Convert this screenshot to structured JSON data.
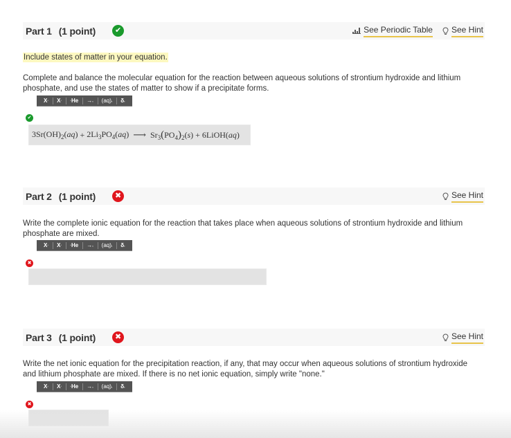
{
  "parts": [
    {
      "title": "Part 1",
      "points": "(1 point)",
      "status": "correct",
      "links": {
        "periodic_table": "See Periodic Table",
        "hint": "See Hint"
      },
      "note": "Include states of matter in your equation.",
      "question": "Complete and balance the molecular equation for the reaction between aqueous solutions of strontium hydroxide and lithium phosphate, and use the states of matter to show if a precipitate forms.",
      "answer_status": "correct",
      "answer": {
        "reactant1": {
          "coef": "3",
          "formula": "Sr(OH)",
          "sub": "2",
          "state": "aq"
        },
        "reactant2": {
          "coef": "2",
          "formula_a": "Li",
          "sub_a": "3",
          "formula_b": "PO",
          "sub_b": "4",
          "state": "aq"
        },
        "arrow": "⟶",
        "product1": {
          "formula_a": "Sr",
          "sub_a": "3",
          "formula_b": "PO",
          "sub_b": "4",
          "sub_c": "2",
          "state": "s"
        },
        "product2": {
          "coef": "6",
          "formula": "LiOH",
          "state": "aq"
        },
        "plus": "+"
      }
    },
    {
      "title": "Part 2",
      "points": "(1 point)",
      "status": "incorrect",
      "links": {
        "hint": "See Hint"
      },
      "question": "Write the complete ionic equation for the reaction that takes place when aqueous solutions of strontium hydroxide and lithium phosphate are mixed.",
      "answer_status": "incorrect",
      "answer_value": ""
    },
    {
      "title": "Part 3",
      "points": "(1 point)",
      "status": "incorrect",
      "links": {
        "hint": "See Hint"
      },
      "question": "Write the net ionic equation for the precipitation reaction, if any, that may occur when aqueous solutions of strontium hydroxide and lithium phosphate are mixed. If there is no net ionic equation, simply write \"none.\"",
      "answer_status": "incorrect",
      "answer_value": ""
    }
  ],
  "toolbar": {
    "superscript": "X",
    "subscript": "X",
    "isotope": "He",
    "arrow": "→",
    "state": "(aq)",
    "delta": "δ"
  },
  "icons": {
    "correct": "✔",
    "incorrect": "✖",
    "dropdown_marker": ","
  },
  "colors": {
    "correct": "#1a9a2c",
    "incorrect": "#e0161d",
    "link_underline": "#e8c44a",
    "highlight": "#fdf8c0"
  }
}
